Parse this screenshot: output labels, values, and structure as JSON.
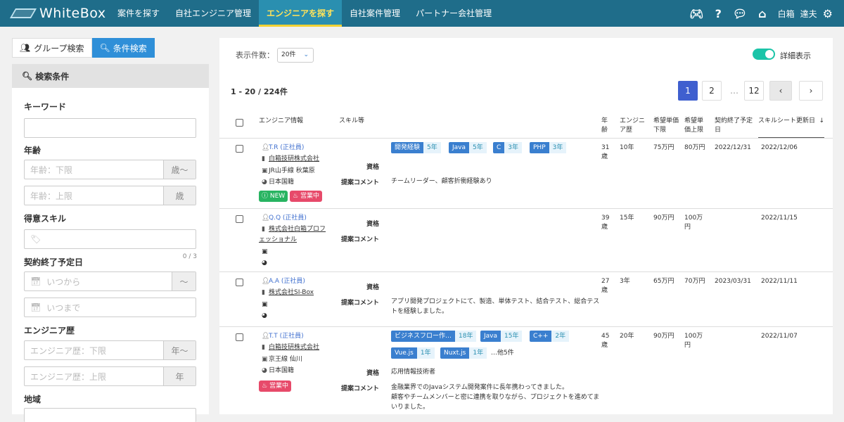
{
  "app": {
    "logo": "WhiteBox"
  },
  "nav": [
    "案件を探す",
    "自社エンジニア管理",
    "エンジニアを探す",
    "自社案件管理",
    "パートナー会社管理"
  ],
  "user": {
    "name1": "白箱",
    "name2": "達夫"
  },
  "tabs": {
    "group": "グループ検索",
    "cond": "条件検索"
  },
  "search": {
    "header": "検索条件",
    "keyword": "キーワード",
    "age": "年齢",
    "age_min": "年齢：下限",
    "age_min_suf": "歳〜",
    "age_max": "年齢：上限",
    "age_max_suf": "歳",
    "skill": "得意スキル",
    "skill_count": "0 / 3",
    "contract": "契約終了予定日",
    "from": "いつから",
    "from_suf": "〜",
    "to": "いつまで",
    "exp": "エンジニア歴",
    "exp_min": "エンジニア歴：下限",
    "exp_min_suf": "年〜",
    "exp_max": "エンジニア歴：上限",
    "exp_max_suf": "年",
    "region": "地域"
  },
  "main": {
    "perpage_label": "表示件数：",
    "perpage": "20件",
    "detail": "詳細表示",
    "count": "1 - 20 / 224件",
    "pages": [
      "1",
      "2",
      "…",
      "12"
    ]
  },
  "cols": {
    "info": "エンジニア情報",
    "skill": "スキル等",
    "age": "年齢",
    "exp": "エンジニア歴",
    "pmin": "希望単価下限",
    "pmax": "希望単価上限",
    "end": "契約終了予定日",
    "updated": "スキルシート更新日",
    "qual": "資格",
    "comment": "提案コメント"
  },
  "rows": [
    {
      "name": "T.R (正社員)",
      "company": "白箱技研株式会社",
      "station": "JR山手線 秋葉原",
      "nation": "日本国籍",
      "age": "31",
      "age_u": "歳",
      "exp": "10年",
      "pmin": "75万円",
      "pmax": "80万円",
      "end": "2022/12/31",
      "updated": "2022/12/06",
      "qual": "",
      "comment": "チームリーダー、顧客折衝経験あり",
      "badge_new": "NEW",
      "badge_sale": "営業中",
      "tags": [
        {
          "n": "開発経験",
          "y": "5年"
        },
        {
          "n": "Java",
          "y": "5年"
        },
        {
          "n": "C",
          "y": "3年"
        },
        {
          "n": "PHP",
          "y": "3年"
        }
      ]
    },
    {
      "name": "Q.Q (正社員)",
      "company": "株式会社白箱プロフ",
      "company2": "ェッショナル",
      "age": "39",
      "age_u": "歳",
      "exp": "15年",
      "pmin": "90万円",
      "pmax": "100万",
      "pmax2": "円",
      "end": "",
      "updated": "2022/11/15",
      "qual": "",
      "comment": ""
    },
    {
      "name": "A.A (正社員)",
      "company": "株式会社SI-Box",
      "age": "27",
      "age_u": "歳",
      "exp": "3年",
      "pmin": "65万円",
      "pmax": "70万円",
      "end": "2023/03/31",
      "updated": "2022/11/11",
      "comment1": "アプリ開発プロジェクトにて、製造、単体テスト、結合テスト、総合テス",
      "comment2": "トを経験しました。"
    },
    {
      "name": "T.T (正社員)",
      "company": "白箱技研株式会社",
      "station": "京王線 仙川",
      "nation": "日本国籍",
      "age": "45",
      "age_u": "歳",
      "exp": "20年",
      "pmin": "90万円",
      "pmax": "100万",
      "pmax2": "円",
      "end": "",
      "updated": "2022/11/07",
      "qual": "応用情報技術者",
      "badge_sale": "営業中",
      "more": "…他5件",
      "comment1": "金融業界でのJavaシステム開発案件に長年携わってきました。",
      "comment2": "顧客やチームメンバーと密に連携を取りながら、プロジェクトを進めてま",
      "comment3": "いりました。",
      "tags": [
        {
          "n": "ビジネスフロー作…",
          "y": "18年"
        },
        {
          "n": "Java",
          "y": "15年"
        },
        {
          "n": "C++",
          "y": "2年"
        },
        {
          "n": "Vue.js",
          "y": "1年"
        },
        {
          "n": "Nuxt.js",
          "y": "1年"
        }
      ]
    }
  ]
}
